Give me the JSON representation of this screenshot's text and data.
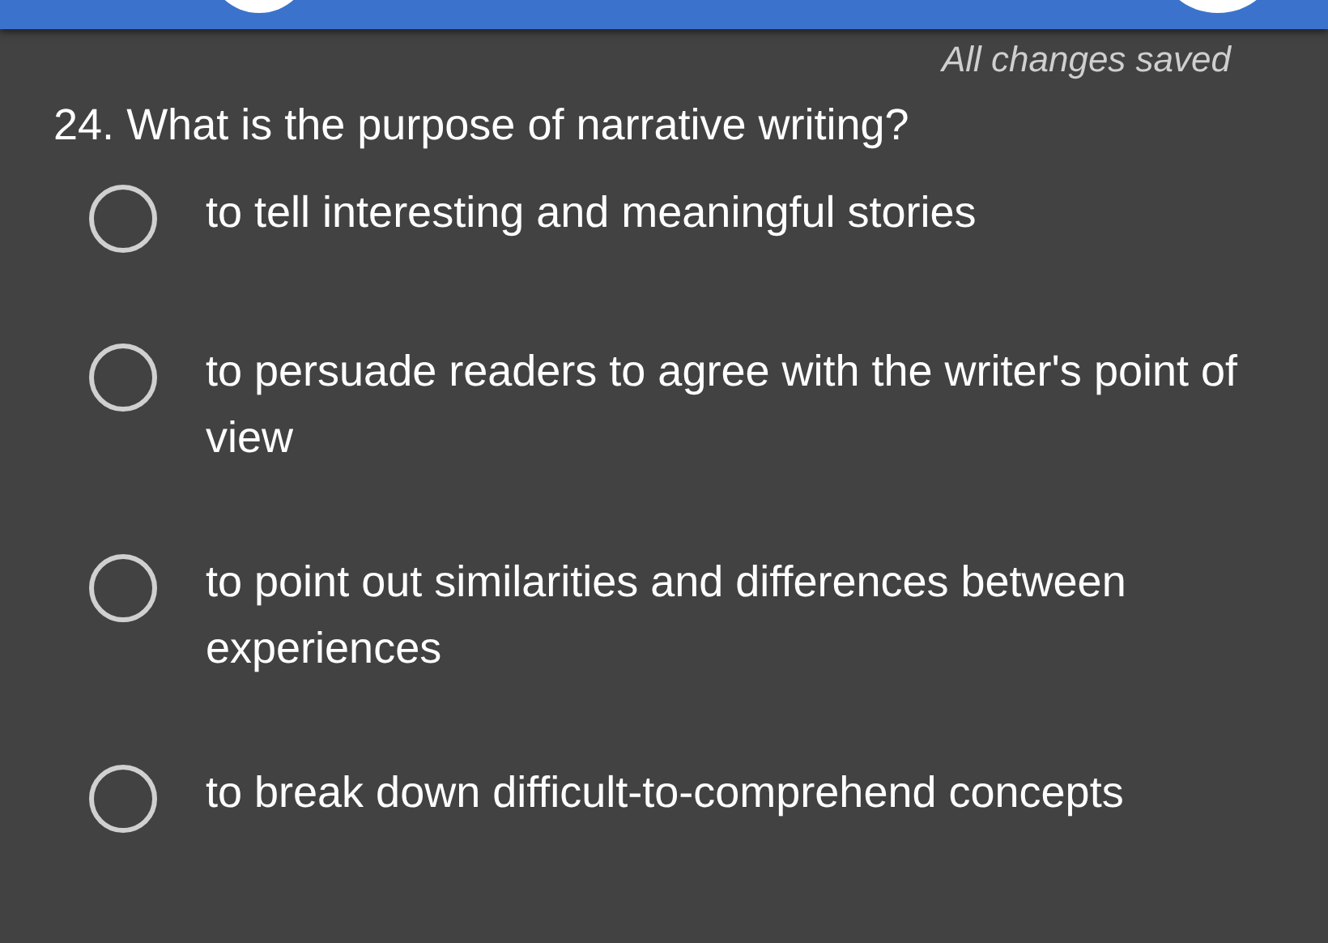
{
  "status": "All changes saved",
  "question": {
    "number": "24.",
    "text": "What is the purpose of narrative writing?"
  },
  "options": [
    {
      "label": "to tell interesting and meaningful stories",
      "selected": false
    },
    {
      "label": "to persuade readers to agree with the writer's point of view",
      "selected": false
    },
    {
      "label": "to point out similarities and differences between experiences",
      "selected": false
    },
    {
      "label": "to break down difficult-to-comprehend concepts",
      "selected": false
    }
  ]
}
